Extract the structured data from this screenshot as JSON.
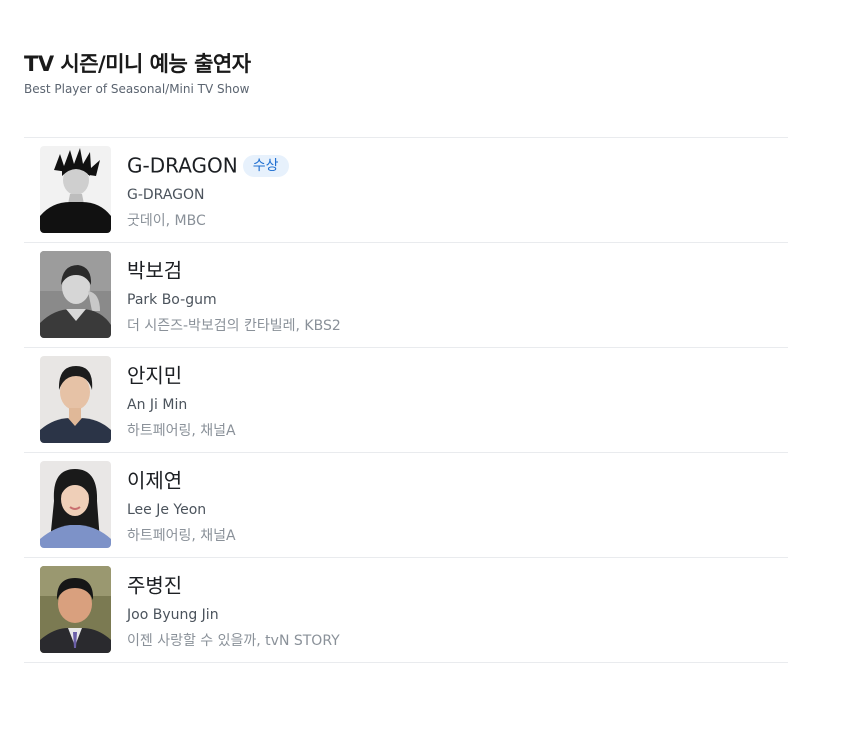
{
  "section": {
    "title": "TV 시즌/미니 예능 출연자",
    "subtitle": "Best Player of Seasonal/Mini TV Show"
  },
  "nominees": [
    {
      "name": "G-DRAGON",
      "badge": "수상",
      "romanized": "G-DRAGON",
      "show": "굿데이, MBC"
    },
    {
      "name": "박보검",
      "romanized": "Park Bo-gum",
      "show": "더 시즌즈-박보검의 칸타빌레, KBS2"
    },
    {
      "name": "안지민",
      "romanized": "An Ji Min",
      "show": "하트페어링, 채널A"
    },
    {
      "name": "이제연",
      "romanized": "Lee Je Yeon",
      "show": "하트페어링, 채널A"
    },
    {
      "name": "주병진",
      "romanized": "Joo Byung Jin",
      "show": "이젠 사랑할 수 있을까, tvN STORY"
    }
  ],
  "colors": {
    "badge_bg": "#e7f1fc",
    "badge_text": "#1f6fd1",
    "divider": "#e9ebee"
  }
}
